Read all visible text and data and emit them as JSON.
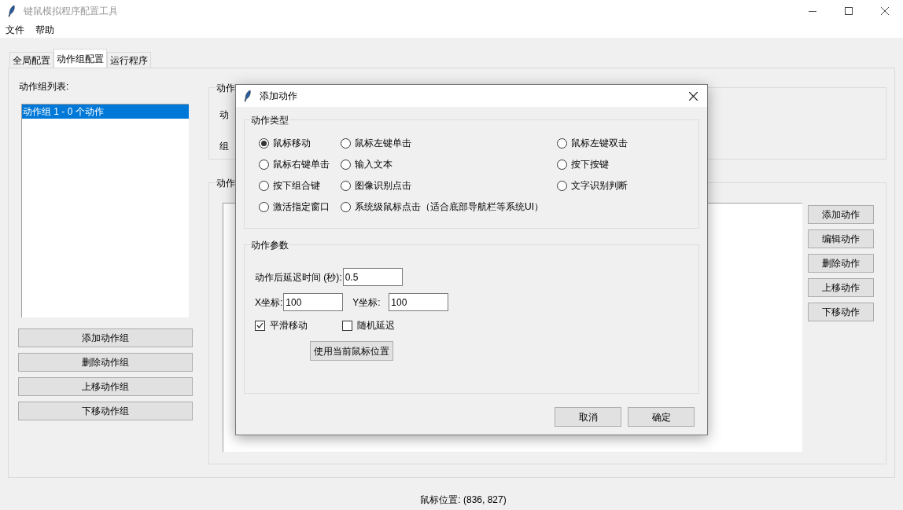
{
  "window": {
    "title": "键鼠模拟程序配置工具"
  },
  "menu": [
    "文件",
    "帮助"
  ],
  "tabs": [
    {
      "label": "全局配置",
      "selected": false
    },
    {
      "label": "动作组配置",
      "selected": true
    },
    {
      "label": "运行程序",
      "selected": false
    }
  ],
  "groups_panel": {
    "label": "动作组列表:",
    "items": [
      {
        "label": "动作组 1 - 0 个动作",
        "selected": true
      }
    ],
    "buttons": [
      "添加动作组",
      "删除动作组",
      "上移动作组",
      "下移动作组"
    ]
  },
  "group_config": {
    "title": "动作",
    "labels": [
      "动",
      "组"
    ]
  },
  "actions_panel": {
    "title": "动作",
    "buttons": [
      "添加动作",
      "编辑动作",
      "删除动作",
      "上移动作",
      "下移动作"
    ]
  },
  "status_bar": "鼠标位置: (836, 827)",
  "dialog": {
    "title": "添加动作",
    "action_type": {
      "title": "动作类型",
      "options": [
        {
          "label": "鼠标移动",
          "selected": true
        },
        {
          "label": "鼠标左键单击",
          "selected": false
        },
        {
          "label": "鼠标左键双击",
          "selected": false
        },
        {
          "label": "鼠标右键单击",
          "selected": false
        },
        {
          "label": "输入文本",
          "selected": false
        },
        {
          "label": "按下按键",
          "selected": false
        },
        {
          "label": "按下组合键",
          "selected": false
        },
        {
          "label": "图像识别点击",
          "selected": false
        },
        {
          "label": "文字识别判断",
          "selected": false
        },
        {
          "label": "激活指定窗口",
          "selected": false
        },
        {
          "label": "系统级鼠标点击（适合底部导航栏等系统UI）",
          "selected": false
        }
      ]
    },
    "params": {
      "title": "动作参数",
      "delay_label": "动作后延迟时间 (秒):",
      "delay_value": "0.5",
      "x_label": "X坐标:",
      "x_value": "100",
      "y_label": "Y坐标:",
      "y_value": "100",
      "checkboxes": [
        {
          "label": "平滑移动",
          "checked": true
        },
        {
          "label": "随机延迟",
          "checked": false
        }
      ],
      "position_button": "使用当前鼠标位置"
    },
    "buttons": [
      "取消",
      "确定"
    ]
  }
}
